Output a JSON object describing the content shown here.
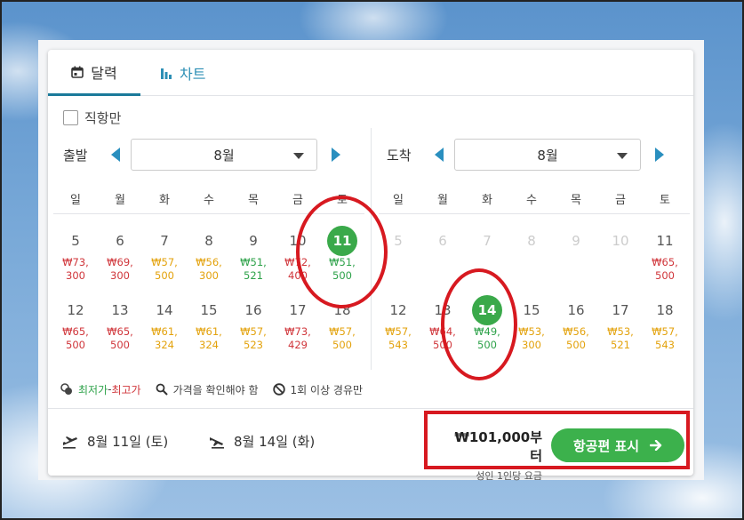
{
  "tabs": [
    {
      "label": "달력",
      "icon": "calendar-icon",
      "active": true
    },
    {
      "label": "차트",
      "icon": "bar-chart-icon",
      "active": false
    }
  ],
  "filter": {
    "direct_only_label": "직항만",
    "checked": false
  },
  "departure": {
    "label": "출발",
    "month": "8월",
    "weekdays": [
      "일",
      "월",
      "화",
      "수",
      "목",
      "금",
      "토"
    ],
    "days": [
      {
        "num": "5",
        "price1": "₩73,",
        "price2": "300",
        "color": "red"
      },
      {
        "num": "6",
        "price1": "₩69,",
        "price2": "300",
        "color": "red"
      },
      {
        "num": "7",
        "price1": "₩57,",
        "price2": "500",
        "color": "orange"
      },
      {
        "num": "8",
        "price1": "₩56,",
        "price2": "300",
        "color": "orange"
      },
      {
        "num": "9",
        "price1": "₩51,",
        "price2": "521",
        "color": "green"
      },
      {
        "num": "10",
        "price1": "₩72,",
        "price2": "400",
        "color": "red"
      },
      {
        "num": "11",
        "price1": "₩51,",
        "price2": "500",
        "color": "green",
        "selected": true
      },
      {
        "num": "12",
        "price1": "₩65,",
        "price2": "500",
        "color": "red"
      },
      {
        "num": "13",
        "price1": "₩65,",
        "price2": "500",
        "color": "red"
      },
      {
        "num": "14",
        "price1": "₩61,",
        "price2": "324",
        "color": "orange"
      },
      {
        "num": "15",
        "price1": "₩61,",
        "price2": "324",
        "color": "orange"
      },
      {
        "num": "16",
        "price1": "₩57,",
        "price2": "523",
        "color": "orange"
      },
      {
        "num": "17",
        "price1": "₩73,",
        "price2": "429",
        "color": "red"
      },
      {
        "num": "18",
        "price1": "₩57,",
        "price2": "500",
        "color": "orange"
      }
    ]
  },
  "arrival": {
    "label": "도착",
    "month": "8월",
    "weekdays": [
      "일",
      "월",
      "화",
      "수",
      "목",
      "금",
      "토"
    ],
    "days": [
      {
        "num": "5",
        "price1": "",
        "price2": "",
        "color": "",
        "disabled": true
      },
      {
        "num": "6",
        "price1": "",
        "price2": "",
        "color": "",
        "disabled": true
      },
      {
        "num": "7",
        "price1": "",
        "price2": "",
        "color": "",
        "disabled": true
      },
      {
        "num": "8",
        "price1": "",
        "price2": "",
        "color": "",
        "disabled": true
      },
      {
        "num": "9",
        "price1": "",
        "price2": "",
        "color": "",
        "disabled": true
      },
      {
        "num": "10",
        "price1": "",
        "price2": "",
        "color": "",
        "disabled": true
      },
      {
        "num": "11",
        "price1": "₩65,",
        "price2": "500",
        "color": "red"
      },
      {
        "num": "12",
        "price1": "₩57,",
        "price2": "543",
        "color": "orange"
      },
      {
        "num": "13",
        "price1": "₩64,",
        "price2": "500",
        "color": "red"
      },
      {
        "num": "14",
        "price1": "₩49,",
        "price2": "500",
        "color": "green",
        "selected": true
      },
      {
        "num": "15",
        "price1": "₩53,",
        "price2": "300",
        "color": "orange"
      },
      {
        "num": "16",
        "price1": "₩56,",
        "price2": "500",
        "color": "orange"
      },
      {
        "num": "17",
        "price1": "₩53,",
        "price2": "521",
        "color": "orange"
      },
      {
        "num": "18",
        "price1": "₩57,",
        "price2": "543",
        "color": "orange"
      }
    ]
  },
  "legend": {
    "lowest": "최저가",
    "separator": " - ",
    "highest": "최고가",
    "check_price": "가격을 확인해야 함",
    "one_stop": "1회 이상 경유만"
  },
  "footer": {
    "outbound_date": "8월 11일 (토)",
    "return_date": "8월 14일 (화)",
    "price": "₩101,000부터",
    "price_note": "성인 1인당 요금",
    "show_flights_label": "항공편 표시"
  },
  "colors": {
    "accent": "#2a8fbf",
    "selected": "#3aa94a",
    "cta": "#3cb14c",
    "price_low": "#2ea24a",
    "price_mid": "#e3a20c",
    "price_high": "#d0363b",
    "annotation": "#d71920"
  }
}
